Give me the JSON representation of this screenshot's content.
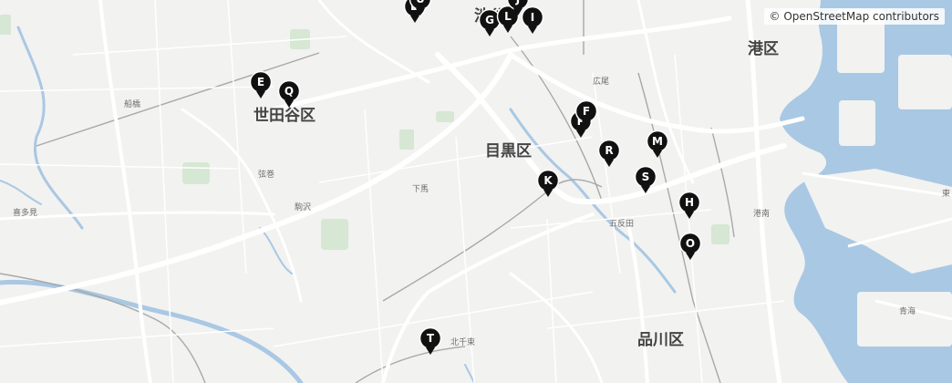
{
  "map": {
    "attribution": "© OpenStreetMap contributors",
    "colors": {
      "land": "#f2f2f1",
      "water": "#a9c8e3",
      "park": "#d5e6d5",
      "road": "#ffffff",
      "rail": "#a8a8a8",
      "marker": "#111111"
    },
    "wards": [
      {
        "name": "渋谷",
        "key": "shibuya"
      },
      {
        "name": "世田谷区",
        "key": "setagaya"
      },
      {
        "name": "目黒区",
        "key": "meguro"
      },
      {
        "name": "港区",
        "key": "minato"
      },
      {
        "name": "品川区",
        "key": "shinagawa"
      }
    ],
    "places": {
      "funabashi": "船橋",
      "hiroo": "広尾",
      "tsurumaki": "弦巻",
      "shimouma": "下馬",
      "komazawa": "駒沢",
      "kitami": "喜多見",
      "gotanda": "五反田",
      "konan": "港南",
      "kitasenzoku": "北千束",
      "aomi": "青海",
      "shinonome": "東"
    },
    "markers": [
      "D",
      "U",
      "G",
      "L",
      "J",
      "I",
      "E",
      "Q",
      "P",
      "F",
      "R",
      "M",
      "K",
      "S",
      "H",
      "O",
      "T"
    ]
  }
}
